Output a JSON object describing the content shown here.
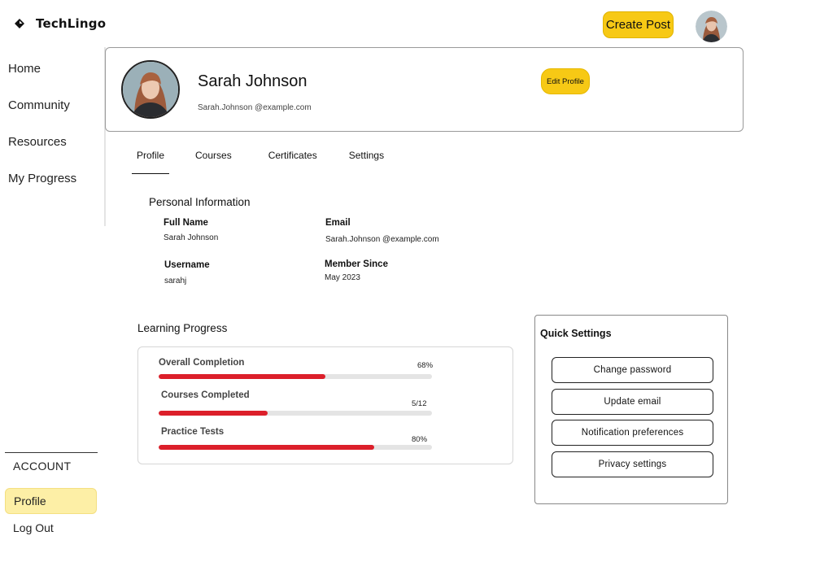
{
  "app": {
    "logo_icon": "diamond-logo-icon",
    "name": "TechLingo"
  },
  "header": {
    "create_post_label": "Create Post",
    "avatar_icon": "user-avatar-icon"
  },
  "sidebar": {
    "items": [
      {
        "label": "Home"
      },
      {
        "label": "Community"
      },
      {
        "label": "Resources"
      },
      {
        "label": "My Progress"
      }
    ],
    "account_label": "ACCOUNT",
    "account_items": [
      {
        "label": "Profile",
        "active": true
      },
      {
        "label": "Log Out"
      }
    ]
  },
  "profile": {
    "name": "Sarah Johnson",
    "email": "Sarah.Johnson @example.com",
    "edit_label": "Edit Profile"
  },
  "tabs": [
    {
      "label": "Profile",
      "active": true
    },
    {
      "label": "Courses"
    },
    {
      "label": "Certificates"
    },
    {
      "label": "Settings"
    }
  ],
  "personal_info": {
    "heading": "Personal Information",
    "full_name_label": "Full Name",
    "full_name": "Sarah Johnson",
    "email_label": "Email",
    "email": "Sarah.Johnson @example.com",
    "username_label": "Username",
    "username": "sarahj",
    "member_since_label": "Member Since",
    "member_since": "May 2023"
  },
  "learning_progress": {
    "heading": "Learning Progress",
    "items": [
      {
        "label": "Overall Completion",
        "value_text": "68%",
        "fraction": 0.61
      },
      {
        "label": "Courses Completed",
        "value_text": "5/12",
        "fraction": 0.4
      },
      {
        "label": "Practice Tests",
        "value_text": "80%",
        "fraction": 0.79
      }
    ],
    "bar_color": "#dc1f2a",
    "track_color": "#e4e4e4"
  },
  "quick_settings": {
    "title": "Quick Settings",
    "buttons": [
      {
        "label": "Change password"
      },
      {
        "label": "Update email"
      },
      {
        "label": "Notification preferences"
      },
      {
        "label": "Privacy settings"
      }
    ]
  },
  "colors": {
    "accent": "#f7c915",
    "accent_soft": "#fdefa6",
    "progress": "#dc1f2a"
  }
}
